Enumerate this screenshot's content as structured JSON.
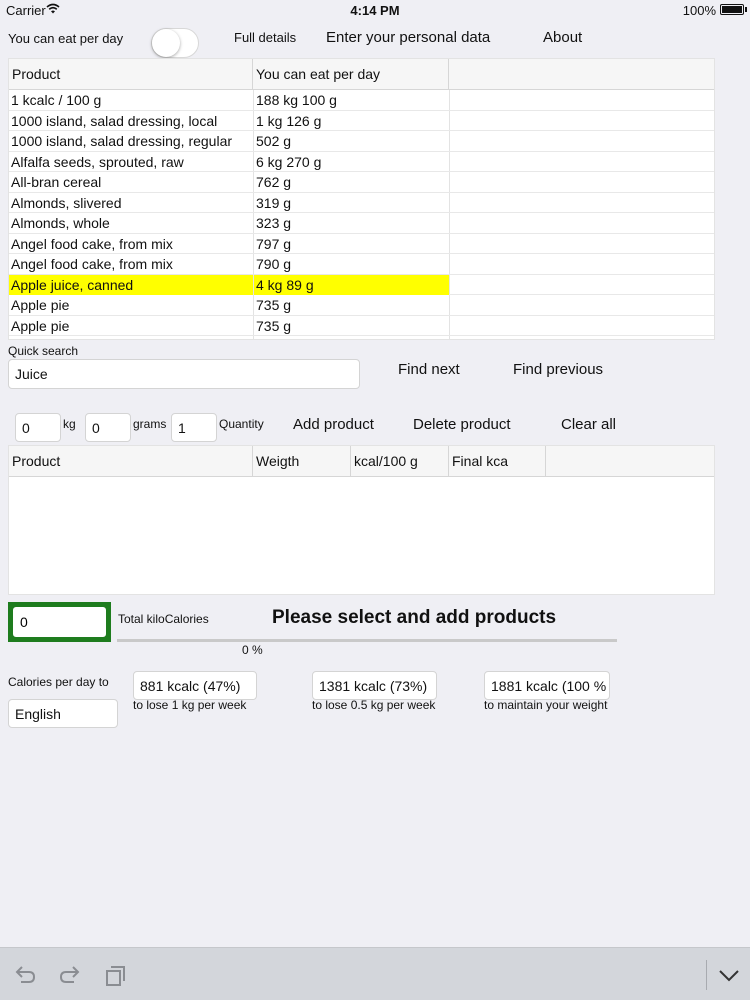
{
  "status_bar": {
    "carrier": "Carrier",
    "time": "4:14 PM",
    "battery": "100%"
  },
  "top_bar": {
    "toggle_label": "You can eat per day",
    "full_details": "Full details",
    "personal_data": "Enter your personal data",
    "about": "About"
  },
  "product_table": {
    "headers": [
      "Product",
      "You can eat per day",
      ""
    ],
    "rows": [
      {
        "product": "1 kcalc / 100 g",
        "amount": "188 kg 100 g"
      },
      {
        "product": "1000 island, salad dressing, local",
        "amount": "1 kg 126 g"
      },
      {
        "product": "1000 island, salad dressing, regular",
        "amount": "502 g"
      },
      {
        "product": "Alfalfa seeds, sprouted, raw",
        "amount": "6 kg 270 g"
      },
      {
        "product": "All-bran cereal",
        "amount": "762 g"
      },
      {
        "product": "Almonds, slivered",
        "amount": "319 g"
      },
      {
        "product": "Almonds, whole",
        "amount": "323 g"
      },
      {
        "product": "Angel food cake, from mix",
        "amount": "797 g"
      },
      {
        "product": "Angel food cake, from mix",
        "amount": "790 g"
      },
      {
        "product": "Apple juice, canned",
        "amount": "4 kg 89 g",
        "highlighted": true
      },
      {
        "product": "Apple pie",
        "amount": "735 g"
      },
      {
        "product": "Apple pie",
        "amount": "735 g"
      }
    ],
    "highlight_color": "#ffff00"
  },
  "search": {
    "label": "Quick search",
    "value": "Juice",
    "find_next": "Find next",
    "find_previous": "Find previous"
  },
  "quantity": {
    "kg_value": "0",
    "kg_label": "kg",
    "grams_value": "0",
    "grams_label": "grams",
    "qty_value": "1",
    "qty_label": "Quantity",
    "add": "Add product",
    "delete": "Delete product",
    "clear": "Clear all"
  },
  "selected_table": {
    "headers": [
      "Product",
      "Weigth",
      "kcal/100 g",
      "Final kca",
      ""
    ]
  },
  "totals": {
    "value": "0",
    "label": "Total kiloCalories",
    "message": "Please select and add products",
    "percent": "0 %",
    "accent": "#1e7c1e"
  },
  "calories": {
    "label": "Calories per day to",
    "language": "English",
    "options": [
      {
        "value": "881 kcalc (47%)",
        "caption": "to lose 1 kg per week"
      },
      {
        "value": "1381 kcalc (73%)",
        "caption": "to lose 0.5 kg per week"
      },
      {
        "value": "1881 kcalc (100 %",
        "caption": "to maintain your weight"
      }
    ]
  },
  "toolbar": {
    "icons": [
      "undo-icon",
      "redo-icon",
      "paste-icon",
      "keyboard-dismiss-icon"
    ]
  }
}
